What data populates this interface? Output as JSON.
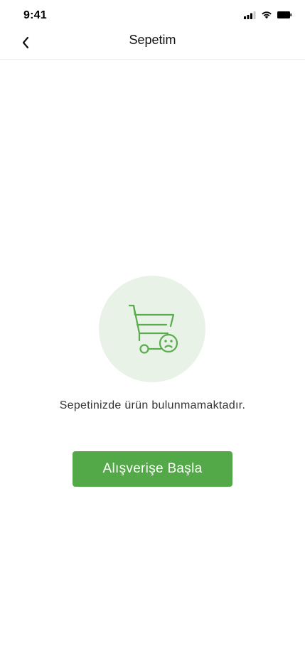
{
  "status_bar": {
    "time": "9:41",
    "icons": [
      "cellular-signal-icon",
      "wifi-icon",
      "battery-icon"
    ]
  },
  "header": {
    "back_icon": "chevron-left-icon",
    "title": "Sepetim"
  },
  "empty_state": {
    "icon": "sad-cart-icon",
    "message": "Sepetinizde ürün bulunmamaktadır.",
    "button_label": "Alışverişe Başla"
  },
  "colors": {
    "accent": "#53a847",
    "icon_circle_bg": "#e8f2e6",
    "icon_stroke": "#5aac4e"
  }
}
